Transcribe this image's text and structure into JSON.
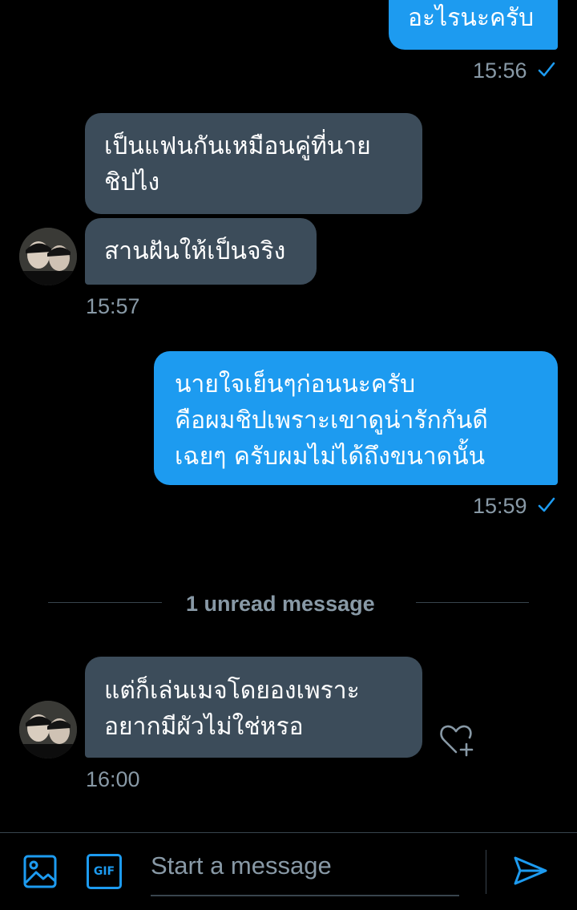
{
  "colors": {
    "background": "#000000",
    "outgoing_bubble": "#1d9bf0",
    "incoming_bubble": "#3c4c5a",
    "muted_text": "#8899a6",
    "accent": "#1d9bf0"
  },
  "messages": [
    {
      "direction": "outgoing",
      "lines": [
        "อะไรนะครับ"
      ],
      "time": "15:56",
      "read_icon": "check-icon"
    },
    {
      "direction": "incoming",
      "lines": [
        "เป็นแฟนกันเหมือนคู่ที่นาย",
        "ชิปไง"
      ]
    },
    {
      "direction": "incoming",
      "lines": [
        "สานฝันให้เป็นจริง"
      ],
      "time": "15:57",
      "avatar_icon": "avatar-icon"
    },
    {
      "direction": "outgoing",
      "lines": [
        "นายใจเย็นๆก่อนนะครับ",
        "คือผมชิปเพราะเขาดูน่ารักกันดี",
        "เฉยๆ ครับผมไม่ได้ถึงขนาดนั้น"
      ],
      "time": "15:59",
      "read_icon": "check-icon"
    },
    {
      "direction": "incoming",
      "lines": [
        "แต่ก็เล่นเมจโดยองเพราะ",
        "อยากมีผัวไม่ใช่หรอ"
      ],
      "time": "16:00",
      "avatar_icon": "avatar-icon",
      "reaction_icon": "heart-plus-icon"
    }
  ],
  "unread_divider": "1 unread message",
  "composer": {
    "image_icon": "image-icon",
    "gif_label": "GIF",
    "placeholder": "Start a message",
    "send_icon": "send-icon"
  }
}
